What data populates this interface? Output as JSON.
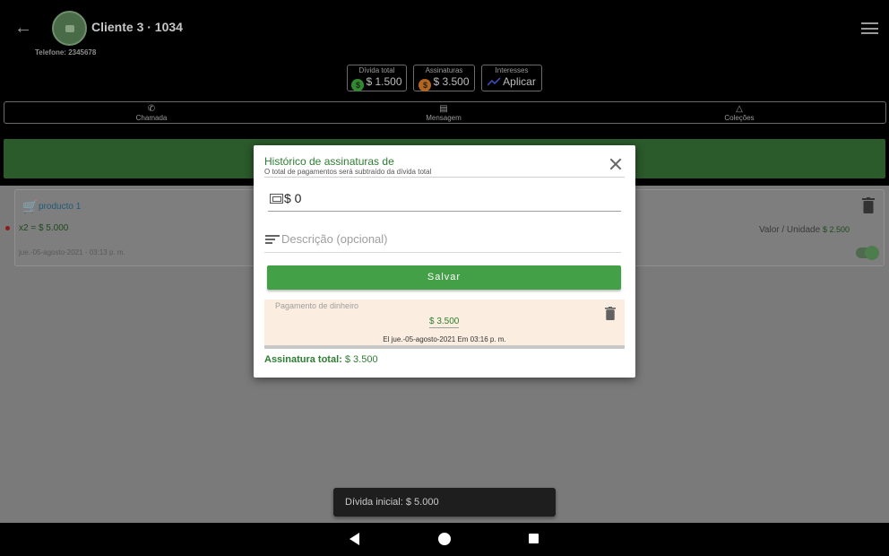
{
  "header": {
    "client_name": "Cliente 3 · 1034",
    "phone": "Telefone: 2345678"
  },
  "stats": [
    {
      "label": "Dívida total",
      "value": "$ 1.500",
      "icon": "dollar-coin-icon"
    },
    {
      "label": "Assinaturas",
      "value": "$ 3.500",
      "icon": "dollar-coin-icon"
    },
    {
      "label": "Interesses",
      "value": "Aplicar",
      "icon": "trending-up-icon"
    }
  ],
  "actions": [
    {
      "label": "Chamada",
      "icon": "phone-icon"
    },
    {
      "label": "Mensagem",
      "icon": "message-icon"
    },
    {
      "label": "Coleções",
      "icon": "bell-icon"
    }
  ],
  "product": {
    "name": "producto 1",
    "total": "x2 = $ 5.000",
    "date": "jue.-05-agosto-2021 · 03:13 p. m.",
    "unit_label": "Valor / Unidade",
    "unit_value": "$ 2.500"
  },
  "modal": {
    "title": "Histórico de assinaturas de",
    "subtitle": "O total de pagamentos será subtraído da dívida total",
    "amount_value": "$ 0",
    "description_placeholder": "Descrição (opcional)",
    "save_label": "Salvar",
    "payment": {
      "type": "Pagamento de dinheiro",
      "amount": "$ 3.500",
      "date": "El jue.-05-agosto-2021 Em 03:16 p. m."
    },
    "total_label": "Assinatura total:",
    "total_value": "$ 3.500"
  },
  "toast": {
    "message": "Dívida inicial: $ 5.000"
  },
  "colors": {
    "accent_green": "#43a047",
    "text_green": "#2e7d32",
    "payment_bg": "#fbeee0"
  }
}
